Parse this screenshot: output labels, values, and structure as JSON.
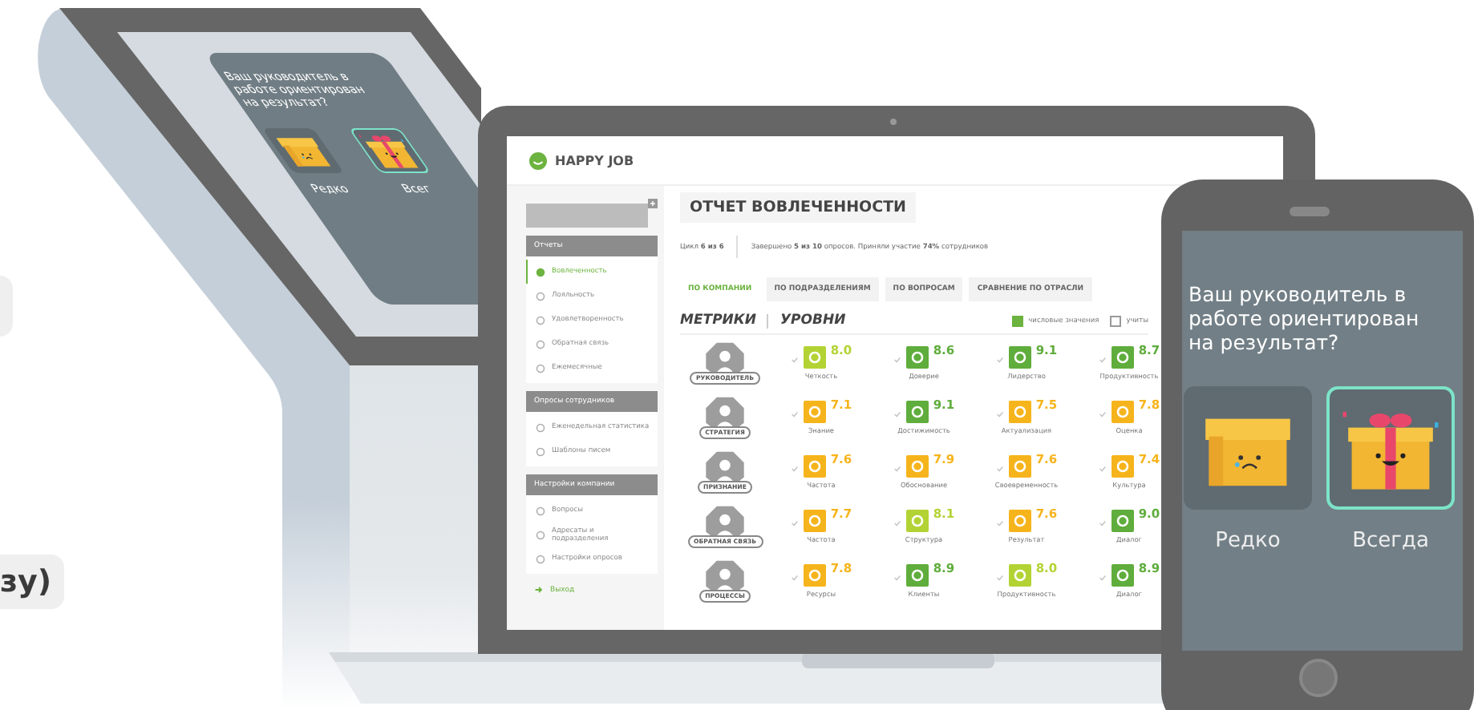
{
  "page_button": {
    "label": "зу)"
  },
  "kiosk": {
    "question": "Ваш руководитель в работе ориентирован на результат?",
    "options": [
      {
        "label": "Редко",
        "kind": "sad-box",
        "selected": false
      },
      {
        "label": "Всег",
        "kind": "gift-box",
        "selected": true
      }
    ]
  },
  "laptop": {
    "logo": "HAPPY JOB",
    "sidebar": {
      "sections": [
        {
          "title": "Отчеты",
          "items": [
            {
              "label": "Вовлеченность",
              "selected": true
            },
            {
              "label": "Лояльность",
              "selected": false
            },
            {
              "label": "Удовлетворенность",
              "selected": false
            },
            {
              "label": "Обратная связь",
              "selected": false
            },
            {
              "label": "Ежемесячные",
              "selected": false
            }
          ]
        },
        {
          "title": "Опросы сотрудников",
          "items": [
            {
              "label": "Еженедельная статистика",
              "selected": false
            },
            {
              "label": "Шаблоны писем",
              "selected": false
            }
          ]
        },
        {
          "title": "Настройки компании",
          "items": [
            {
              "label": "Вопросы",
              "selected": false
            },
            {
              "label": "Адресаты и подразделения",
              "selected": false
            },
            {
              "label": "Настройки опросов",
              "selected": false
            }
          ]
        }
      ],
      "logout": "Выход"
    },
    "report": {
      "title": "ОТЧЕТ ВОВЛЕЧЕННОСТИ",
      "cycle": "Цикл **6 из 6**",
      "summary": "Завершено **5 из 10** опросов. Приняли участие **74%** сотрудников",
      "tabs": [
        {
          "label": "ПО КОМПАНИИ",
          "selected": true
        },
        {
          "label": "ПО ПОДРАЗДЕЛЕНИЯМ",
          "selected": false
        },
        {
          "label": "ПО ВОПРОСАМ",
          "selected": false
        },
        {
          "label": "СРАВНЕНИЕ ПО ОТРАСЛИ",
          "selected": false
        }
      ],
      "views": [
        "МЕТРИКИ",
        "УРОВНИ"
      ],
      "options": [
        {
          "label": "числовые значения",
          "checked": true
        },
        {
          "label": "учиты",
          "checked": false
        }
      ],
      "rows": [
        {
          "category": "РУКОВОДИТЕЛЬ",
          "metrics": [
            {
              "label": "Четкость",
              "value": "8.0",
              "color": "#b3d334"
            },
            {
              "label": "Доверие",
              "value": "8.6",
              "color": "#5fad3c"
            },
            {
              "label": "Лидерство",
              "value": "9.1",
              "color": "#5fad3c"
            },
            {
              "label": "Продуктивность",
              "value": "8.7",
              "color": "#5fad3c"
            }
          ]
        },
        {
          "category": "СТРАТЕГИЯ",
          "metrics": [
            {
              "label": "Знание",
              "value": "7.1",
              "color": "#f6b41c"
            },
            {
              "label": "Достижимость",
              "value": "9.1",
              "color": "#5fad3c"
            },
            {
              "label": "Актуализация",
              "value": "7.5",
              "color": "#f6b41c"
            },
            {
              "label": "Оценка",
              "value": "7.8",
              "color": "#f6b41c"
            }
          ]
        },
        {
          "category": "ПРИЗНАНИЕ",
          "metrics": [
            {
              "label": "Частота",
              "value": "7.6",
              "color": "#f6b41c"
            },
            {
              "label": "Обоснование",
              "value": "7.9",
              "color": "#f6b41c"
            },
            {
              "label": "Своевременность",
              "value": "7.6",
              "color": "#f6b41c"
            },
            {
              "label": "Культура",
              "value": "7.4",
              "color": "#f6b41c"
            }
          ]
        },
        {
          "category": "ОБРАТНАЯ СВЯЗЬ",
          "metrics": [
            {
              "label": "Частота",
              "value": "7.7",
              "color": "#f6b41c"
            },
            {
              "label": "Структура",
              "value": "8.1",
              "color": "#b3d334"
            },
            {
              "label": "Результат",
              "value": "7.6",
              "color": "#f6b41c"
            },
            {
              "label": "Диалог",
              "value": "9.0",
              "color": "#5fad3c"
            }
          ]
        },
        {
          "category": "ПРОЦЕССЫ",
          "metrics": [
            {
              "label": "Ресурсы",
              "value": "7.8",
              "color": "#f6b41c"
            },
            {
              "label": "Клиенты",
              "value": "8.9",
              "color": "#5fad3c"
            },
            {
              "label": "Продуктивность",
              "value": "8.0",
              "color": "#b3d334"
            },
            {
              "label": "Диалог",
              "value": "8.9",
              "color": "#5fad3c"
            }
          ]
        }
      ]
    }
  },
  "phone": {
    "question": "Ваш руководитель в работе ориентирован на результат?",
    "options": [
      {
        "label": "Редко",
        "kind": "sad-box",
        "selected": false
      },
      {
        "label": "Всегда",
        "kind": "gift-box",
        "selected": true
      }
    ]
  }
}
